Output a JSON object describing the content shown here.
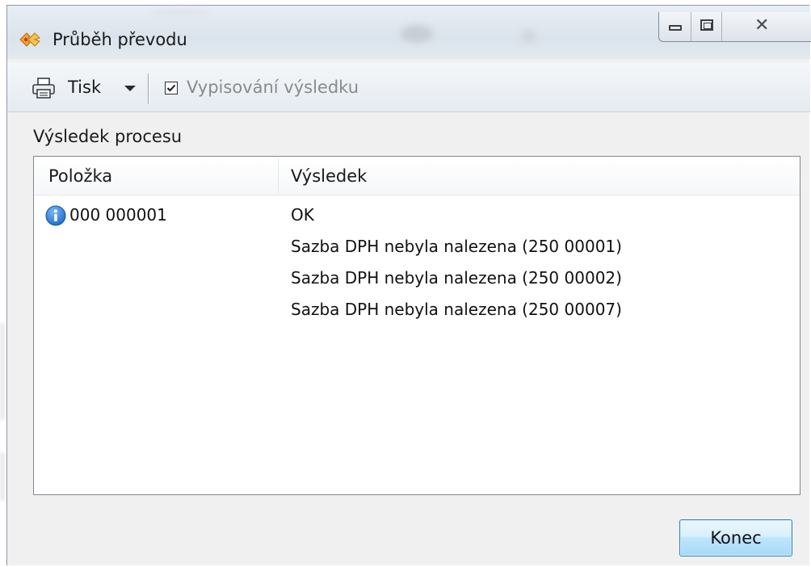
{
  "window": {
    "title": "Průběh převodu"
  },
  "toolbar": {
    "print_label": "Tisk",
    "checkbox_label": "Vypisování výsledku",
    "checkbox_checked": true
  },
  "content": {
    "section_label": "Výsledek procesu",
    "columns": [
      "Položka",
      "Výsledek"
    ],
    "rows": [
      {
        "item": "000 000001",
        "icon": "info-icon",
        "results": [
          "OK",
          "Sazba DPH nebyla nalezena (250 00001)",
          "Sazba DPH nebyla nalezena (250 00002)",
          "Sazba DPH nebyla nalezena (250 00007)"
        ]
      }
    ]
  },
  "footer": {
    "close_button_label": "Konec"
  },
  "colors": {
    "info_icon": "#1f6fd0",
    "button_border": "#3c7fb1"
  }
}
